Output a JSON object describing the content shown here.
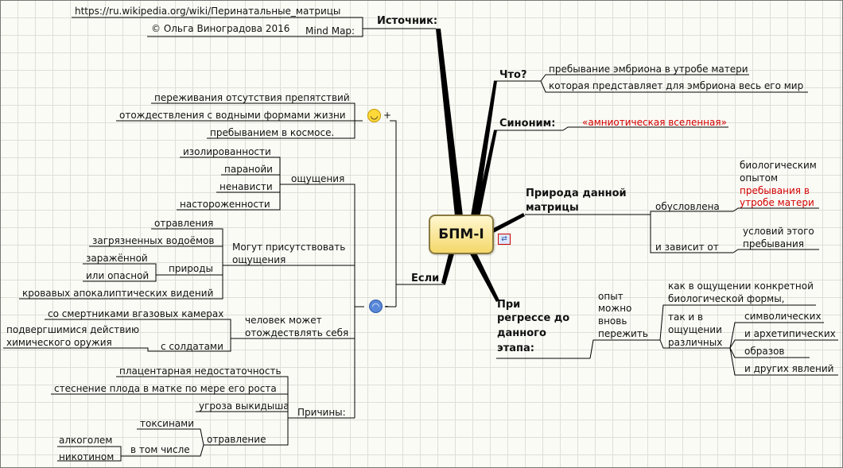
{
  "center": "БПМ-I",
  "source": {
    "title": "Источник:",
    "url": "https://ru.wikipedia.org/wiki/Перинатальные_матрицы",
    "mindmap_label": "Mind Map:",
    "author": "© Ольга Виноградова 2016"
  },
  "what": {
    "title": "Что?",
    "line1": "пребывание эмбриона в утробе матери",
    "line2": "которая представляет для эмбриона весь его мир"
  },
  "synonym": {
    "title": "Синоним:",
    "value": "«амниотическая вселенная»"
  },
  "nature": {
    "title1": "Природа данной",
    "title2": "матрицы",
    "conditioned": "обусловлена",
    "bio1": "биологическим",
    "bio2": "опытом",
    "bio3": "пребывания в",
    "bio4": "утробе матери",
    "depends": "и зависит от",
    "cond1": "условий этого",
    "cond2": "пребывания"
  },
  "regress": {
    "title1": "При",
    "title2": "регрессе до",
    "title3": "данного",
    "title4": "этапа:",
    "exp1": "опыт",
    "exp2": "можно",
    "exp3": "вновь",
    "exp4": "пережить",
    "as1": "как в ощущении конкретной",
    "as2": "биологической формы,",
    "also1": "так и в",
    "also2": "ощущении",
    "also3": "различных",
    "symbolic": "символических",
    "archetypal": "и архетипических",
    "images": "образов",
    "other": "и других явлений"
  },
  "if": {
    "title": "Если",
    "plus": "+",
    "minus": "-",
    "positive": [
      "переживания отсутствия препятствий",
      "отождествления с водными формами жизни",
      "пребыванием в космосе."
    ],
    "sensations_label": "ощущения",
    "sensations": [
      "изолированности",
      "паранойи",
      "ненависти",
      "настороженности"
    ],
    "may1": "Могут присутствовать",
    "may2": "ощущения",
    "poisoning": "отравления",
    "polluted": "загрязненных водоёмов",
    "nature_label": "природы",
    "infected": "заражённой",
    "dangerous": "или опасной",
    "apocalyptic": "кровавых апокалиптических видений",
    "person1": "человек может",
    "person2": "отождествлять себя",
    "gas": "со смертниками вгазовых камерах",
    "chem1": "подвергшимися действию",
    "chem2": "химического оружия",
    "soldiers": "с солдатами",
    "causes": "Причины:",
    "placental": "плацентарная недостаточность",
    "constraint": "стеснение плода в матке по мере его роста",
    "miscarriage": "угроза выкидыша",
    "poison": "отравление",
    "toxins": "токсинами",
    "including": "в том числе",
    "alcohol": "алкоголем",
    "nicotine": "никотином"
  },
  "colors": {
    "line": "#000000",
    "accent": "#d40000",
    "center_fill": "#f4d86a"
  }
}
